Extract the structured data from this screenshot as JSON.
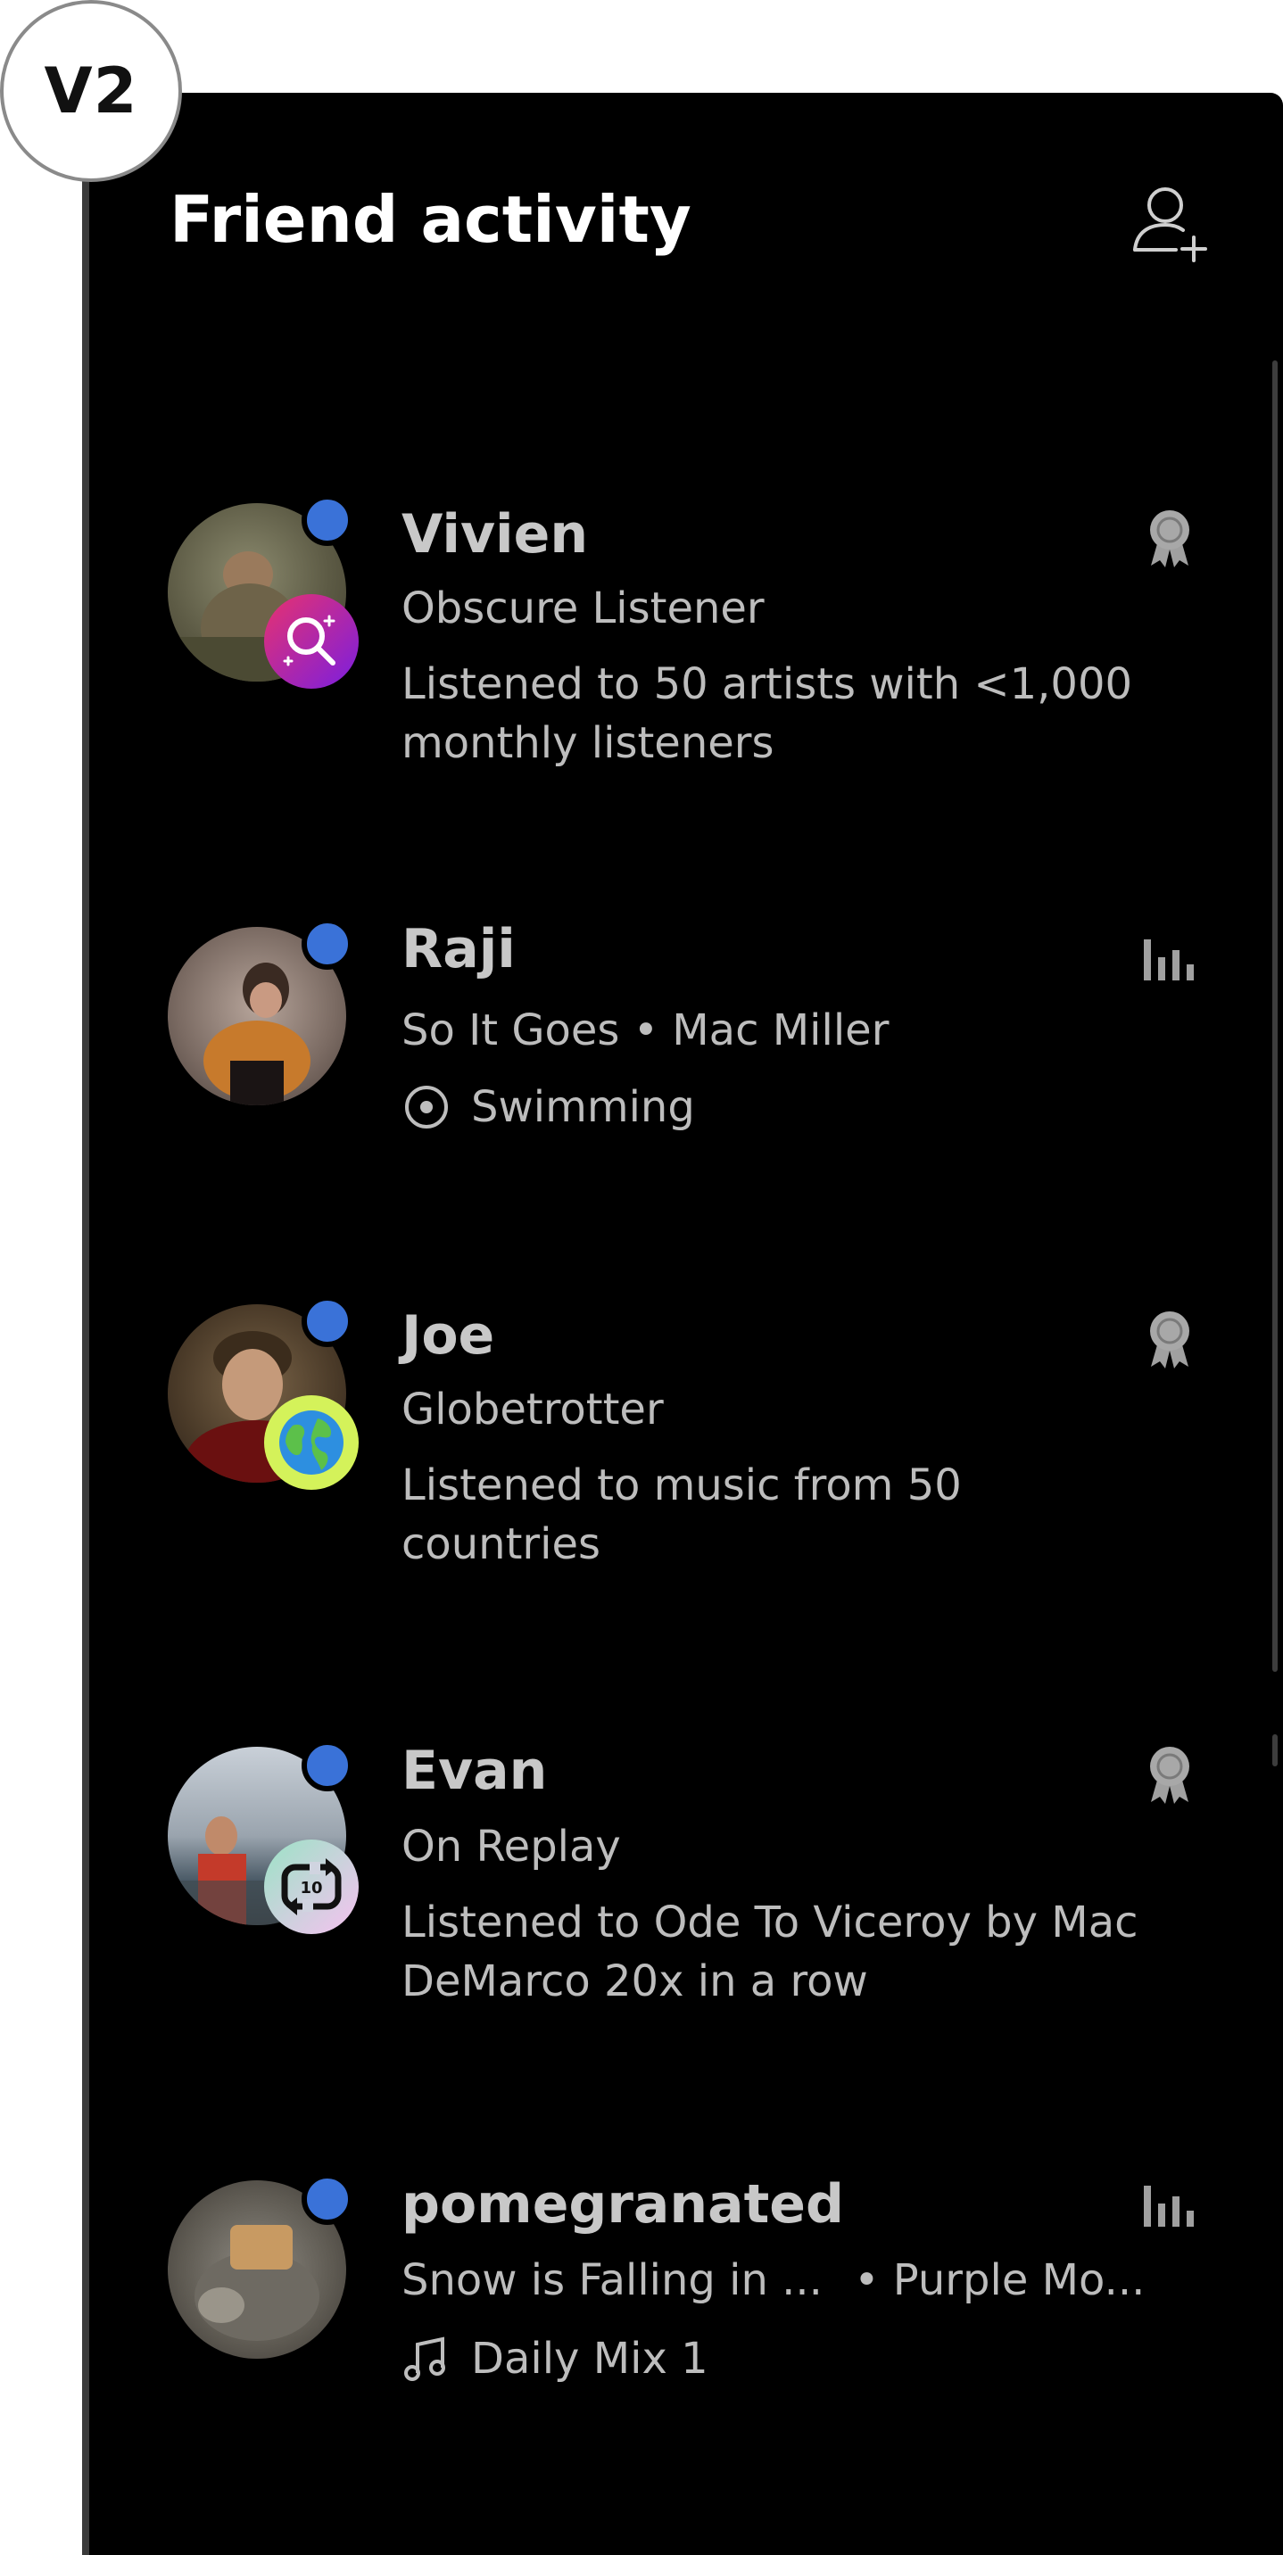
{
  "version_badge": "V2",
  "header": {
    "title": "Friend activity",
    "add_friend_icon": "add-friend-icon"
  },
  "friends": [
    {
      "name": "Vivien",
      "line1": "Obscure Listener",
      "line2": "Listened to 50 artists with <1,000 monthly listeners",
      "status_icon": "award-ribbon-icon",
      "achievement_icon": "magnifier-sparkle-icon",
      "achievement_color": "#8a2be2"
    },
    {
      "name": "Raji",
      "line1": "So It Goes • Mac Miller",
      "line2": "Swimming",
      "line2_icon": "radio-target-icon",
      "status_icon": "equalizer-bars-icon"
    },
    {
      "name": "Joe",
      "line1": "Globetrotter",
      "line2": "Listened to music from 50 countries",
      "status_icon": "award-ribbon-icon",
      "achievement_icon": "globe-icon",
      "achievement_color": "#d4f25a"
    },
    {
      "name": "Evan",
      "line1": "On Replay",
      "line2": "Listened to Ode To Viceroy by Mac DeMarco 20x in a row",
      "status_icon": "award-ribbon-icon",
      "achievement_icon": "repeat-10-icon",
      "achievement_color": "#f3c6ee"
    },
    {
      "name": "pomegranated",
      "line1a": "Snow is Falling in ...",
      "line1b": "• Purple Mo...",
      "line2": "Daily Mix 1",
      "line2_icon": "music-note-icon",
      "status_icon": "equalizer-bars-icon"
    }
  ],
  "repeat_badge_text": "10",
  "colors": {
    "panel_bg": "#000000",
    "online_dot": "#3a72d8",
    "text_primary": "#ffffff",
    "text_secondary": "#bdbdbd"
  }
}
